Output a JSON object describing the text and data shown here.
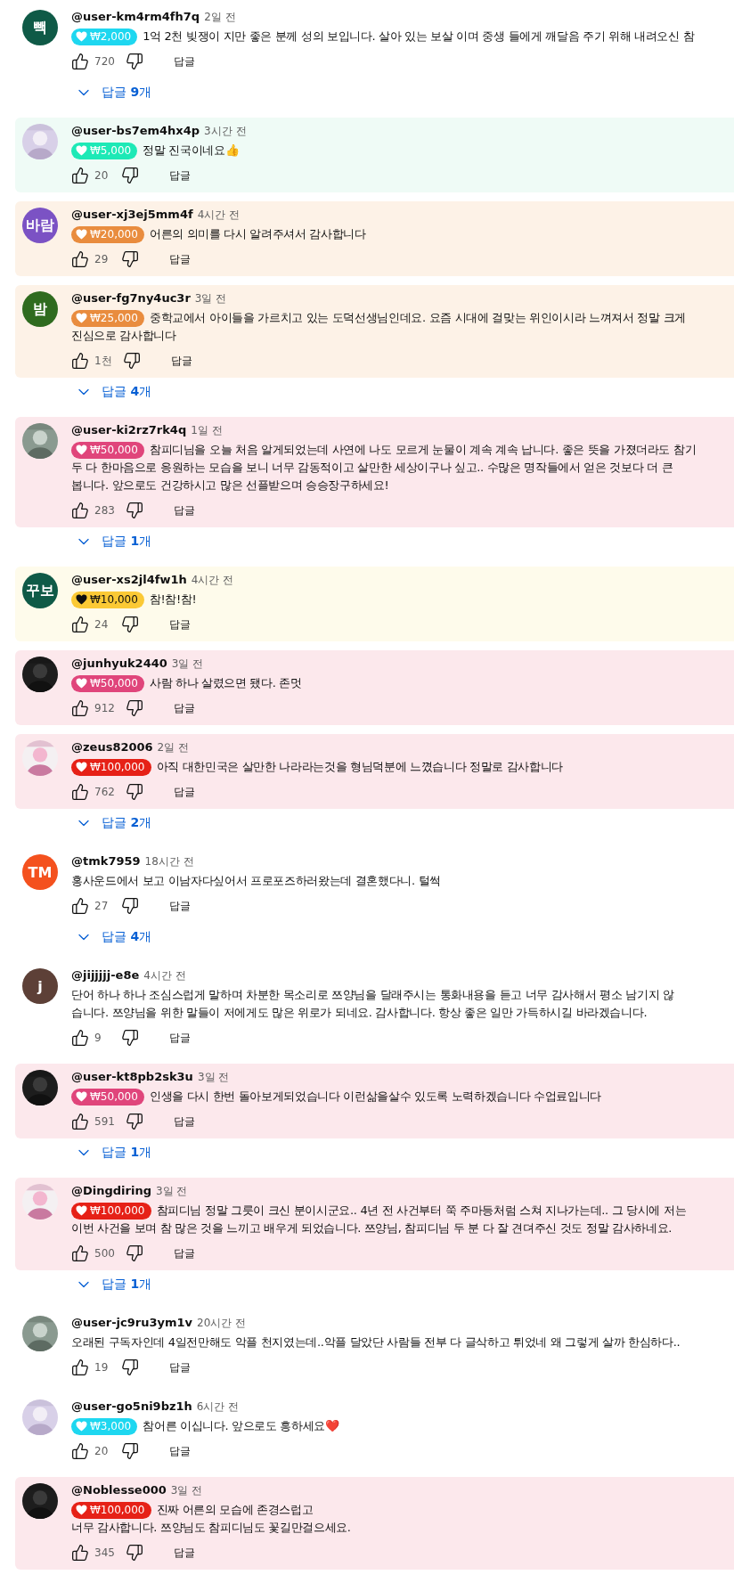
{
  "comments": [
    {
      "avatar": {
        "kind": "letters",
        "text": "빽",
        "color": "#0f5a47"
      },
      "handle": "@user-km4rm4fh7q",
      "time": "2일 전",
      "superchat": {
        "amount": "₩2,000",
        "color": "#1ed7f0"
      },
      "lines": [
        "1억 2천 빚쟁이 지만 좋은 분께 성의 보입니다. 살아 있는 보살 이며 중생 들에게 깨달음 주기 위해 내려오신 참"
      ],
      "likes": "720",
      "reply": "답글",
      "replies": "답글 **9**개"
    },
    {
      "avatar": {
        "kind": "picture"
      },
      "handle": "@user-bs7em4hx4p",
      "time": "3시간 전",
      "superchat": {
        "amount": "₩5,000",
        "color": "#1de9b6"
      },
      "color": "#effbf6",
      "lines": [
        "정말 진국이네요👍"
      ],
      "likes": "20",
      "reply": "답글"
    },
    {
      "avatar": {
        "kind": "letters",
        "text": "바람",
        "color": "#7b52c4"
      },
      "handle": "@user-xj3ej5mm4f",
      "time": "4시간 전",
      "superchat": {
        "amount": "₩20,000",
        "color": "#e98c3e"
      },
      "color": "#fdf2e7",
      "lines": [
        "어른의 의미를 다시 알려주셔서 감사합니다"
      ],
      "likes": "29",
      "reply": "답글"
    },
    {
      "avatar": {
        "kind": "letters",
        "text": "밤",
        "color": "#2f6b1f"
      },
      "handle": "@user-fg7ny4uc3r",
      "time": "3일 전",
      "superchat": {
        "amount": "₩25,000",
        "color": "#e98c3e"
      },
      "color": "#fdf2e7",
      "lines": [
        "중학교에서 아이들을 가르치고 있는 도덕선생님인데요. 요즘 시대에  걸맞는 위인이시라 느껴져서 정말 크게",
        "진심으로 감사합니다"
      ],
      "likes": "1천",
      "reply": "답글",
      "replies": "답글 **4**개"
    },
    {
      "avatar": {
        "kind": "picture"
      },
      "handle": "@user-ki2rz7rk4q",
      "time": "1일 전",
      "superchat": {
        "amount": "₩50,000",
        "color": "#e0457b"
      },
      "color": "#fce8ec",
      "lines": [
        "참피디님을 오늘 처음 알게되었는데 사연에 나도 모르게 눈물이 계속 계속 납니다. 좋은 뜻을 가졌더라도 참기",
        "두 다 한마음으로 응원하는 모습을 보니 너무 감동적이고 살만한 세상이구나 싶고.. 수많은 명작들에서 얻은 것보다 더 큰",
        "봅니다.  앞으로도 건강하시고 많은 선플받으며 승승장구하세요!"
      ],
      "likes": "283",
      "reply": "답글",
      "replies": "답글 **1**개"
    },
    {
      "avatar": {
        "kind": "letters",
        "text": "꾸보",
        "color": "#0f5a47"
      },
      "handle": "@user-xs2jl4fw1h",
      "time": "4시간 전",
      "superchat": {
        "amount": "₩10,000",
        "color": "#fbc935"
      },
      "color": "#fefbeb",
      "lines": [
        "참!참!참!"
      ],
      "likes": "24",
      "reply": "답글"
    },
    {
      "avatar": {
        "kind": "picture"
      },
      "handle": "@junhyuk2440",
      "time": "3일 전",
      "superchat": {
        "amount": "₩50,000",
        "color": "#e0457b"
      },
      "color": "#fce8ec",
      "lines": [
        "사람 하나 살렸으면 됐다. 존멋"
      ],
      "likes": "912",
      "reply": "답글"
    },
    {
      "avatar": {
        "kind": "picture"
      },
      "handle": "@zeus82006",
      "time": "2일 전",
      "superchat": {
        "amount": "₩100,000",
        "color": "#e62117"
      },
      "color": "#fce8ec",
      "lines": [
        "아직 대한민국은 살만한 나라라는것을 형님덕분에 느꼈습니다 정말로 감사합니다"
      ],
      "likes": "762",
      "reply": "답글",
      "replies": "답글 **2**개"
    },
    {
      "avatar": {
        "kind": "letters",
        "text": "TM",
        "color": "#f4511e"
      },
      "handle": "@tmk7959",
      "time": "18시간 전",
      "lines": [
        "홍사운드에서 보고 이남자다싶어서 프로포즈하러왔는데 결혼했다니. 털썩"
      ],
      "likes": "27",
      "reply": "답글",
      "replies": "답글 **4**개"
    },
    {
      "avatar": {
        "kind": "letters",
        "text": "j",
        "color": "#5d4037"
      },
      "handle": "@jijjjjj-e8e",
      "time": "4시간 전",
      "lines": [
        "단어 하나 하나 조심스럽게 말하며 차분한 목소리로 쯔양님을 달래주시는 통화내용을 듣고 너무 감사해서 평소 남기지 않",
        "습니다. 쯔양님을 위한 말들이 저에게도 많은 위로가 되네요. 감사합니다. 항상 좋은 일만 가득하시길 바라겠습니다."
      ],
      "likes": "9",
      "reply": "답글"
    },
    {
      "avatar": {
        "kind": "picture"
      },
      "handle": "@user-kt8pb2sk3u",
      "time": "3일 전",
      "superchat": {
        "amount": "₩50,000",
        "color": "#e0457b"
      },
      "color": "#fce8ec",
      "lines": [
        "인생을 다시 한번 돌아보게되었습니다 이런삶을살수 있도록 노력하겠습니다 수업료입니다"
      ],
      "likes": "591",
      "reply": "답글",
      "replies": "답글 **1**개"
    },
    {
      "avatar": {
        "kind": "picture"
      },
      "handle": "@Dingdiring",
      "time": "3일 전",
      "superchat": {
        "amount": "₩100,000",
        "color": "#e62117"
      },
      "color": "#fce8ec",
      "lines": [
        "참피디님 정말 그릇이 크신 분이시군요.. 4년 전 사건부터 쭉 주마등처럼 스쳐 지나가는데.. 그 당시에 저는",
        "이번 사건을 보며 참 많은 것을 느끼고 배우게 되었습니다. 쯔양님, 참피디님 두 분 다 잘 견뎌주신 것도 정말 감사하네요."
      ],
      "likes": "500",
      "reply": "답글",
      "replies": "답글 **1**개"
    },
    {
      "avatar": {
        "kind": "picture"
      },
      "handle": "@user-jc9ru3ym1v",
      "time": "20시간 전",
      "lines": [
        "오래된 구독자인데 4일전만해도 악플 천지였는데..악플 달았단 사람들 전부 다 글삭하고 튀었네 왜 그렇게 살까 한심하다.."
      ],
      "likes": "19",
      "reply": "답글"
    },
    {
      "avatar": {
        "kind": "picture"
      },
      "handle": "@user-go5ni9bz1h",
      "time": "6시간 전",
      "superchat": {
        "amount": "₩3,000",
        "color": "#1ed7f0"
      },
      "lines": [
        "참어른 이십니다. 앞으로도 흥하세요❤️"
      ],
      "likes": "20",
      "reply": "답글"
    },
    {
      "avatar": {
        "kind": "picture"
      },
      "handle": "@Noblesse000",
      "time": "3일 전",
      "superchat": {
        "amount": "₩100,000",
        "color": "#e62117"
      },
      "color": "#fce8ec",
      "lines": [
        "진짜 어른의 모습에 존경스럽고",
        "너무 감사합니다. 쯔양님도 참피디님도 꽃길만걸으세요."
      ],
      "likes": "345",
      "reply": "답글"
    }
  ]
}
